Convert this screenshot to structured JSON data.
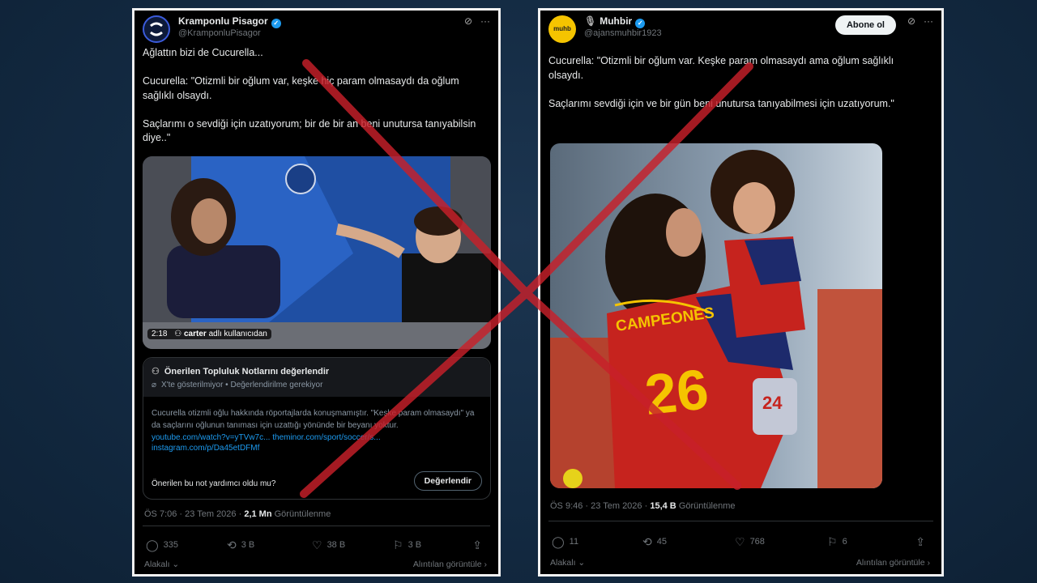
{
  "left": {
    "username": "Kramponlu Pisagor",
    "handle": "@KramponluPisagor",
    "tweet": "Ağlattın bizi de Cucurella...\n\nCucurella: \"Otizmli bir oğlum var, keşke hiç param olmasaydı da oğlum sağlıklı olsaydı.\n\nSaçlarımı o sevdiği için uzatıyorum; bir de bir an beni unutursa tanıyabilsin diye..\"",
    "video_time": "2:18",
    "video_caption": "carter",
    "video_caption2": "adlı kullanıcıdan",
    "note_title": "Önerilen Topluluk Notlarını değerlendir",
    "note_sub": "X'te gösterilmiyor • Değerlendirilme gerekiyor",
    "note_body": "Cucurella otizmli oğlu hakkında röportajlarda konuşmamıştır. \"Keşke param olmasaydı\" ya da saçlarını oğlunun tanıması için uzattığı yönünde bir beyanı yoktur.",
    "note_link1": "youtube.com/watch?v=yTVw7c... theminor.com/sport/soccer/s...",
    "note_link2": "instagram.com/p/Da45etDFMf",
    "note_question": "Önerilen bu not yardımcı oldu mu?",
    "rate_button": "Değerlendir",
    "time": "ÖS 7:06 · 23 Tem 2026 ·",
    "views": "2,1 Mn",
    "views_label": "Görüntülenme",
    "replies": "335",
    "retweets": "3 B",
    "likes": "38 B",
    "bookmarks": "3 B",
    "related": "Alakalı",
    "quotes": "Alıntılan görüntüle"
  },
  "right": {
    "username": "Muhbir",
    "handle": "@ajansmuhbir1923",
    "subscribe": "Abone ol",
    "tweet": "Cucurella: \"Otizmli bir oğlum var. Keşke param olmasaydı ama oğlum sağlıklı olsaydı.\n\nSaçlarımı sevdiği için ve bir gün beni unutursa tanıyabilmesi için uzatıyorum.\"",
    "jersey_text": "CAMPEONES",
    "jersey_number": "26",
    "kid_number": "24",
    "time": "ÖS 9:46 · 23 Tem 2026 ·",
    "views": "15,4 B",
    "views_label": "Görüntülenme",
    "replies": "11",
    "retweets": "45",
    "likes": "768",
    "bookmarks": "6",
    "related": "Alakalı",
    "quotes": "Alıntılan görüntüle"
  },
  "colors": {
    "cross": "#c8202a",
    "verified": "#1d9bf0",
    "muhbir_logo": "#f5c400"
  }
}
